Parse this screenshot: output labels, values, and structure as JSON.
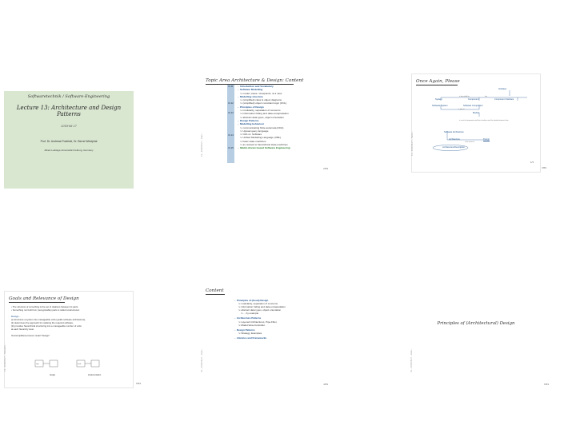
{
  "slides": {
    "s1": {
      "subtitle": "Softwaretechnik / Software-Engineering",
      "title": "Lecture 13: Architecture and Design Patterns",
      "date": "2018-06-27",
      "author": "Prof. Dr. Andreas Podelski, Dr. Bernd Westphal",
      "affiliation": "Albert-Ludwigs-Universität Freiburg, Germany",
      "bg": "#d9e6d0"
    },
    "s2": {
      "title": "Topic Area Architecture & Design: Content",
      "side": "13 – 2018-06-27 – main –",
      "page": "2/53",
      "tags": [
        "VL 11",
        "VL 12",
        "VL 13",
        "VL 14",
        "VL 15"
      ],
      "items": [
        {
          "t": "Introduction and Vocabulary",
          "k": "h"
        },
        {
          "t": "Software Modelling",
          "k": "h"
        },
        {
          "t": "model; views / viewpoints; 4+1 view",
          "k": "sub"
        },
        {
          "t": "Modelling structure",
          "k": "h"
        },
        {
          "t": "(simplified) class & object diagrams",
          "k": "sub"
        },
        {
          "t": "(simplified) object constraint logic (OCL)",
          "k": "sub"
        },
        {
          "t": "Principles of Design",
          "k": "h"
        },
        {
          "t": "modularity, separation of concerns",
          "k": "sub"
        },
        {
          "t": "information hiding and data encapsulation",
          "k": "sub"
        },
        {
          "t": "abstract data types, object orientation",
          "k": "sub"
        },
        {
          "t": "Design Patterns",
          "k": "h"
        },
        {
          "t": "Modelling behaviour",
          "k": "h"
        },
        {
          "t": "communicating finite automata (CFA)",
          "k": "sub"
        },
        {
          "t": "Uppaal query language",
          "k": "sub"
        },
        {
          "t": "CFA vs. Software",
          "k": "sub"
        },
        {
          "t": "Unified Modelling Language (UML)",
          "k": "sub"
        },
        {
          "t": "basic state-machines",
          "k": "sub"
        },
        {
          "t": "an outlook to hierarchical state-machines",
          "k": "sub"
        },
        {
          "t": "Model-driven/-based Software Engineering",
          "k": "green"
        }
      ]
    },
    "s3": {
      "title": "Once Again, Please",
      "side": "13 – 2018-06-27 – Sarch –",
      "page": "3/53",
      "pnum": "1/3",
      "nodes": {
        "interface": "Interface",
        "system": "System",
        "component": "Component",
        "component_interface": "Component Interface",
        "software_system": "Software System",
        "software_component": "Software Component",
        "module": "Module",
        "software_architecture": "Software Architecture",
        "architecture": "Architecture",
        "design": "Design",
        "architectural_description": "Architectural Description"
      },
      "notes": {
        "n1": "is described by",
        "n2": "has",
        "n3": "is part of",
        "n4": "is the result of",
        "n5": "is a set of components and their interfaces and the relation between them"
      }
    },
    "s4": {
      "title": "Goals and Relevance of Design",
      "side": "13 – 2018-06-27 – Sdesintro –",
      "page": "5/53",
      "bullets": [
        "The structure of something is the set of relations between its parts.",
        "Something not built from (recognisable) parts is called unstructured."
      ],
      "design_label": "Design...",
      "design_items": [
        "(i) structures a system into manageable units (yields software architecture),",
        "(ii) determines the approach for realising the required software,",
        "(iii) provides hierarchical structuring into a manageable number of units",
        "     at each hierarchy level."
      ],
      "model_label": "Oversimplified process model \"Design\":",
      "box1": "req.",
      "box2": "design",
      "box3": "arch.",
      "box4": "implementation"
    },
    "s5": {
      "title": "Content",
      "side": "13 – 2018-06-27 – main –",
      "page": "4/53",
      "items": [
        {
          "t": "Principles of (Good) Design",
          "k": "h"
        },
        {
          "t": "modularity, separation of concerns",
          "k": "sub"
        },
        {
          "t": "information hiding and data encapsulation",
          "k": "sub"
        },
        {
          "t": "abstract data types, object orientation",
          "k": "sub"
        },
        {
          "t": "... by example",
          "k": "subsub"
        },
        {
          "t": "Architecture Patterns",
          "k": "h"
        },
        {
          "t": "Layered Architectures, Pipe-Filter,",
          "k": "sub"
        },
        {
          "t": "Model-View-Controller.",
          "k": "sub"
        },
        {
          "t": "Design Patterns",
          "k": "h"
        },
        {
          "t": "Strategy, Examples",
          "k": "sub"
        },
        {
          "t": "Libraries and Frameworks",
          "k": "h"
        }
      ]
    },
    "s6": {
      "title": "Principles of (Architectural) Design",
      "side": "13 – 2018-06-27 – main –",
      "page": "6/53"
    }
  }
}
